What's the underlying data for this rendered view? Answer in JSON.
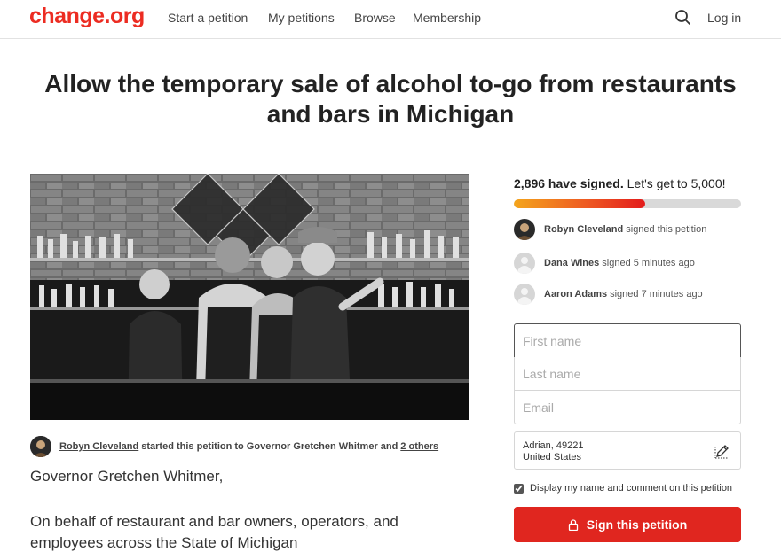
{
  "header": {
    "logo": "change.org",
    "nav": [
      "Start a petition",
      "My petitions",
      "Browse",
      "Membership"
    ],
    "login": "Log in",
    "icons": {
      "search": "search-icon"
    }
  },
  "petition": {
    "title": "Allow the temporary sale of alcohol to-go from restaurants and bars in Michigan",
    "starter_name": "Robyn Cleveland",
    "starter_text": "started this petition to Governor Gretchen Whitmer",
    "and_text": "and",
    "others_link": "2 others",
    "body_greeting": "Governor Gretchen Whitmer,",
    "body_line_1": "On behalf of restaurant and bar owners, operators, and",
    "body_line_2": "employees across the State of Michigan"
  },
  "progress": {
    "signed_count": "2,896 have signed.",
    "goal_text": "Let's get to 5,000!",
    "fraction": 0.5792
  },
  "recent_signers": [
    {
      "name": "Robyn Cleveland",
      "action": "signed this petition"
    },
    {
      "name": "Dana Wines",
      "action": "signed 5 minutes ago"
    },
    {
      "name": "Aaron Adams",
      "action": "signed 7 minutes ago"
    }
  ],
  "form": {
    "first_name_placeholder": "First name",
    "last_name_placeholder": "Last name",
    "email_placeholder": "Email",
    "location_line_1": "Adrian, 49221",
    "location_line_2": "United States",
    "consent_label": "Display my name and comment on this petition",
    "consent_checked": true,
    "sign_button": "Sign this petition"
  },
  "colors": {
    "brand": "#ec2c22",
    "button": "#e0261f",
    "progress_start": "#f4a51c",
    "progress_end": "#e31c1c"
  }
}
